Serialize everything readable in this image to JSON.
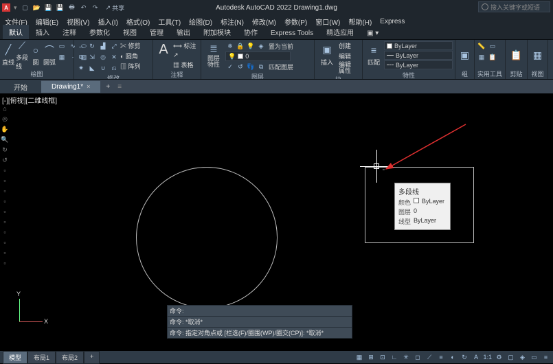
{
  "app": {
    "title": "Autodesk AutoCAD 2022  Drawing1.dwg"
  },
  "search": {
    "placeholder": "搜入关键字或短语"
  },
  "qat": {
    "share_label": "共享"
  },
  "menu": {
    "items": [
      "文件(F)",
      "编辑(E)",
      "视图(V)",
      "插入(I)",
      "格式(O)",
      "工具(T)",
      "绘图(D)",
      "标注(N)",
      "修改(M)",
      "参数(P)",
      "窗口(W)",
      "帮助(H)",
      "Express"
    ]
  },
  "ribbon_tabs": {
    "items": [
      "默认",
      "插入",
      "注释",
      "参数化",
      "视图",
      "管理",
      "输出",
      "附加模块",
      "协作",
      "Express Tools",
      "精选应用"
    ],
    "active_index": 0
  },
  "panels": {
    "draw": {
      "title": "绘图",
      "line": "直线",
      "polyline": "多段线",
      "circle": "圆",
      "arc": "圆弧"
    },
    "modify": {
      "title": "修改",
      "items": [
        "✂ 修剪",
        "◐ 圆角",
        "▥ 阵列"
      ]
    },
    "annot": {
      "title": "注释",
      "text": "文字",
      "dim": "标注",
      "table": "表格"
    },
    "layers": {
      "title": "图层",
      "btn": "图层\n特性",
      "current": "0"
    },
    "block": {
      "title": "块",
      "insert": "插入",
      "edit_label": "编辑\n属性",
      "items": [
        "创建",
        "编辑"
      ]
    },
    "props": {
      "title": "特性",
      "match": "匹配",
      "color": "ByLayer",
      "lw": "ByLayer",
      "lt": "ByLayer"
    },
    "group": {
      "title": "组"
    },
    "util": {
      "title": "实用工具"
    },
    "clip": {
      "title": "剪贴板"
    },
    "view": {
      "title": "视图"
    }
  },
  "doc_tabs": {
    "start": "开始",
    "tabs": [
      "Drawing1*"
    ]
  },
  "viewport": {
    "label": "[-][俯视][二维线框]"
  },
  "tooltip": {
    "title": "多段线",
    "rows": [
      {
        "k": "颜色",
        "v": "ByLayer",
        "sw": true
      },
      {
        "k": "图层",
        "v": "0"
      },
      {
        "k": "线型",
        "v": "ByLayer"
      }
    ]
  },
  "cmd": {
    "l1": "命令:",
    "l2": "命令: *取消*",
    "l3": "命令: 指定对角点或 [栏选(F)/圈围(WP)/圈交(CP)]: *取消*"
  },
  "ucs": {
    "x": "X",
    "y": "Y"
  },
  "layout": {
    "tabs": [
      "模型",
      "布局1",
      "布局2"
    ],
    "plus": "+"
  }
}
